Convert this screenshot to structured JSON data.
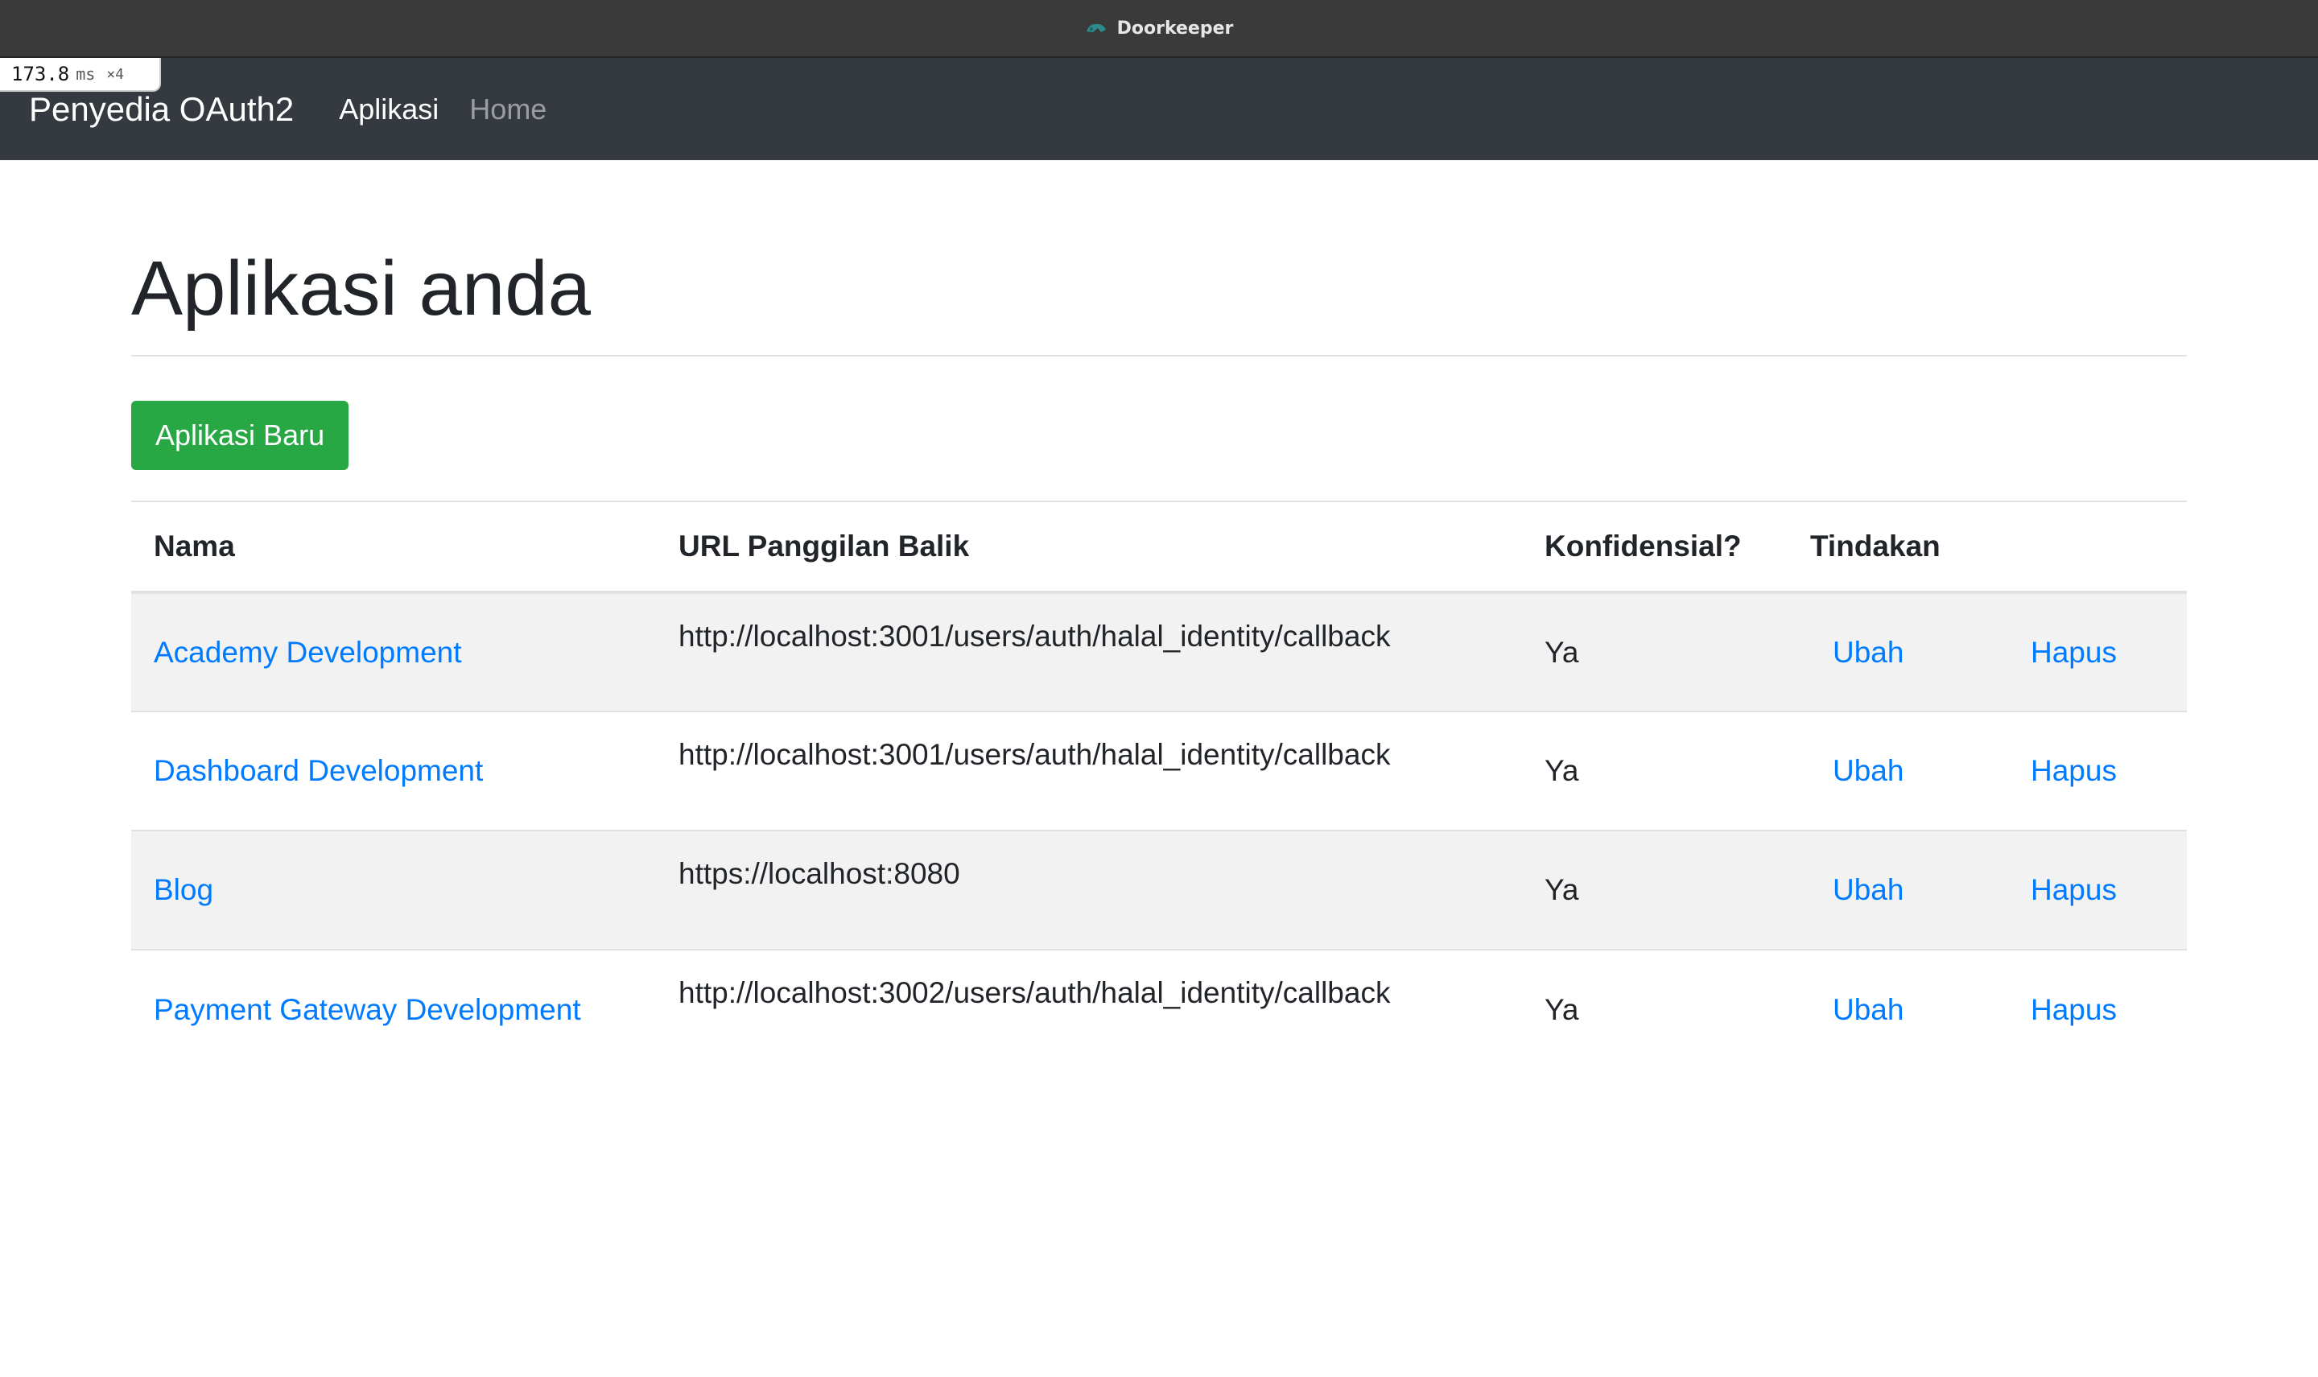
{
  "window": {
    "title": "Doorkeeper",
    "icon": "doorkeeper-logo-icon"
  },
  "profiler": {
    "time": "173.8",
    "unit": "ms",
    "count": "×4"
  },
  "navbar": {
    "brand": "Penyedia OAuth2",
    "links": [
      {
        "label": "Aplikasi",
        "active": true
      },
      {
        "label": "Home",
        "active": false
      }
    ]
  },
  "page": {
    "title": "Aplikasi anda",
    "new_button": "Aplikasi Baru"
  },
  "table": {
    "headers": [
      "Nama",
      "URL Panggilan Balik",
      "Konfidensial?",
      "Tindakan"
    ],
    "rows": [
      {
        "name": "Academy Development",
        "callback_url": "http://localhost:3001/users/auth/halal_identity/callback",
        "confidential": "Ya",
        "edit": "Ubah",
        "delete": "Hapus"
      },
      {
        "name": "Dashboard Development",
        "callback_url": "http://localhost:3001/users/auth/halal_identity/callback",
        "confidential": "Ya",
        "edit": "Ubah",
        "delete": "Hapus"
      },
      {
        "name": "Blog",
        "callback_url": "https://localhost:8080",
        "confidential": "Ya",
        "edit": "Ubah",
        "delete": "Hapus"
      },
      {
        "name": "Payment Gateway Development",
        "callback_url": "http://localhost:3002/users/auth/halal_identity/callback",
        "confidential": "Ya",
        "edit": "Ubah",
        "delete": "Hapus"
      }
    ]
  },
  "colors": {
    "navbar_bg": "#343a40",
    "titlebar_bg": "#3a3a3a",
    "success": "#28a745",
    "link": "#007bff",
    "stripe": "#f2f2f2"
  }
}
